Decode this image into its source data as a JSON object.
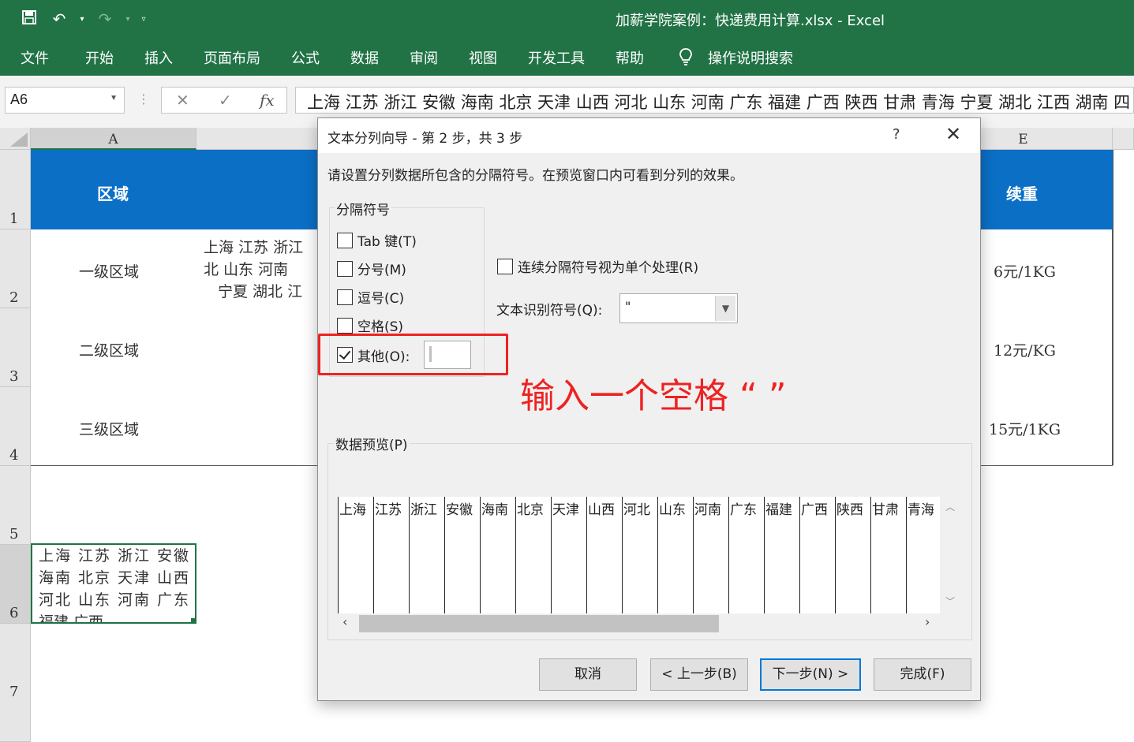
{
  "quick_access": {
    "save_icon": "save-icon",
    "undo_icon": "undo-icon",
    "redo_icon": "redo-icon",
    "customize_icon": "customize-qat-icon"
  },
  "window_title": "加薪学院案例：快递费用计算.xlsx  -  Excel",
  "ribbon_tabs": [
    "文件",
    "开始",
    "插入",
    "页面布局",
    "公式",
    "数据",
    "审阅",
    "视图",
    "开发工具",
    "帮助"
  ],
  "tell_me": "操作说明搜索",
  "name_box": "A6",
  "formula_bar": {
    "cancel": "✕",
    "enter": "✓",
    "fx": "fx",
    "content": "上海 江苏 浙江 安徽 海南 北京 天津 山西 河北 山东 河南 广东 福建 广西 陕西 甘肃 青海 宁夏 湖北 江西 湖南 四"
  },
  "columns": [
    "A",
    "E"
  ],
  "rows": [
    "1",
    "2",
    "3",
    "4",
    "5",
    "6",
    "7"
  ],
  "sheet": {
    "header_col_a": "区域",
    "header_col_e": "续重",
    "rows": [
      {
        "region": "一级区域",
        "extra": "6元/1KG"
      },
      {
        "region": "二级区域",
        "extra": "12元/KG"
      },
      {
        "region": "三级区域",
        "extra": "15元/1KG"
      }
    ],
    "b2_lines": [
      "上海  江苏  浙江",
      "北  山东  河南",
      "宁夏  湖北  江"
    ],
    "a6_text": "上海 江苏 浙江 安徽 海南 北京 天津 山西 河北 山东 河南 广东 福建 广西"
  },
  "dialog": {
    "title": "文本分列向导 - 第 2 步，共 3 步",
    "help": "?",
    "close": "✕",
    "description": "请设置分列数据所包含的分隔符号。在预览窗口内可看到分列的效果。",
    "delimiters_label": "分隔符号",
    "checkboxes": [
      {
        "label": "Tab 键(T)",
        "checked": false
      },
      {
        "label": "分号(M)",
        "checked": false
      },
      {
        "label": "逗号(C)",
        "checked": false
      },
      {
        "label": "空格(S)",
        "checked": false
      },
      {
        "label": "其他(O):",
        "checked": true
      }
    ],
    "other_value": " ",
    "consecutive_label": "连续分隔符号视为单个处理(R)",
    "consecutive_checked": false,
    "text_qualifier_label": "文本识别符号(Q):",
    "text_qualifier_value": "\"",
    "preview_label": "数据预览(P)",
    "preview_columns": [
      "上海",
      "江苏",
      "浙江",
      "安徽",
      "海南",
      "北京",
      "天津",
      "山西",
      "河北",
      "山东",
      "河南",
      "广东",
      "福建",
      "广西",
      "陕西",
      "甘肃",
      "青海"
    ],
    "buttons": {
      "cancel": "取消",
      "back": "< 上一步(B)",
      "next": "下一步(N) >",
      "finish": "完成(F)"
    }
  },
  "annotation": "输入一个空格 “ ”",
  "colors": {
    "excel_green": "#217346",
    "header_blue": "#0b6fc6",
    "annotation_red": "#ee2222"
  }
}
